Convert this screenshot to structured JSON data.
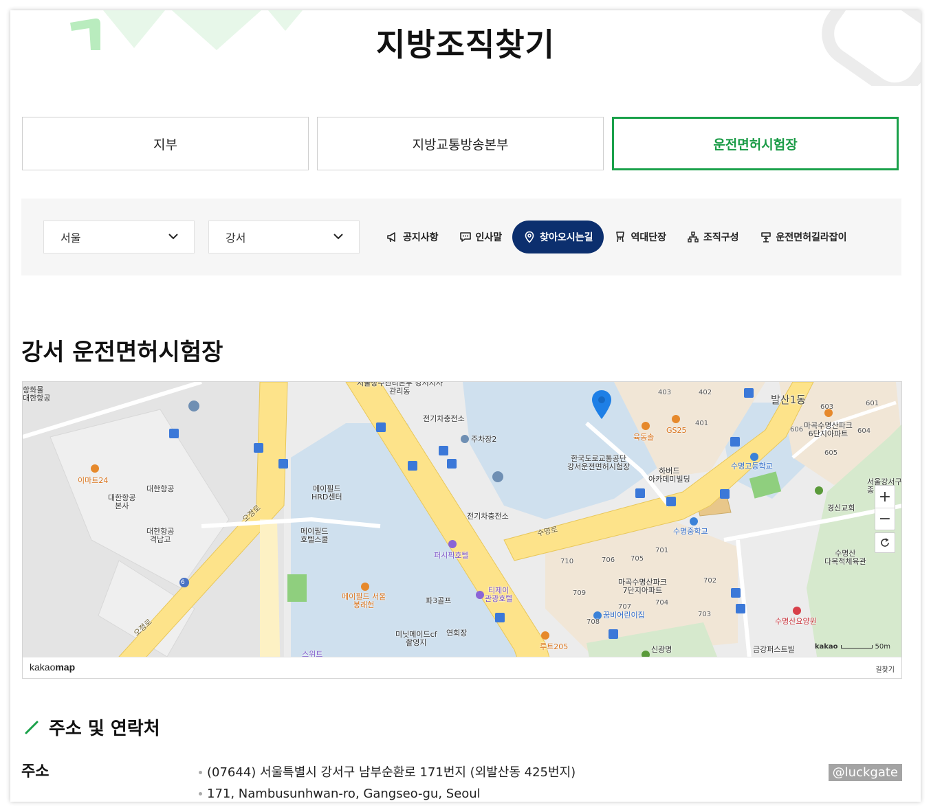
{
  "page_title": "지방조직찾기",
  "tabs": [
    {
      "label": "지부"
    },
    {
      "label": "지방교통방송본부"
    },
    {
      "label": "운전면허시험장"
    }
  ],
  "filters": {
    "region": "서울",
    "branch": "강서"
  },
  "quick_links": [
    {
      "label": "공지사항",
      "icon": "megaphone-icon"
    },
    {
      "label": "인사말",
      "icon": "chat-icon"
    },
    {
      "label": "찾아오시는길",
      "icon": "location-pin-icon",
      "active": true
    },
    {
      "label": "역대단장",
      "icon": "person-icon"
    },
    {
      "label": "조직구성",
      "icon": "org-chart-icon"
    },
    {
      "label": "운전면허길라잡이",
      "icon": "signpost-icon"
    }
  ],
  "section_title": "강서 운전면허시험장",
  "map": {
    "labels": {
      "top_left_1": "항화물",
      "top_left_2": "대한항공",
      "emart": "이마트24",
      "kal_hq": "대한항공\n본사",
      "kal": "대한항공",
      "kal_hangar": "대한항공\n격납고",
      "ojeong_1": "오정로",
      "ojeong_2": "오정로",
      "route_6": "6",
      "hrd": "메이필드\nHRD센터",
      "hotel_school": "메이필드\n호텔스쿨",
      "bongraehun": "메이필드 서울\n봉래헌",
      "pacific": "퍼시픽호텔",
      "par3": "파3골프",
      "mixmade": "미닛메이드cf\n촬영지",
      "yeonhoe": "연회장",
      "tj": "티제이\n관광호텔",
      "ev_1": "전기차충전소",
      "parking_2": "주차장2",
      "ev_2": "전기차충전소",
      "top_center": "서울상수관리본부 강서지사\n관리동",
      "sumyeongro": "수명로",
      "test_site": "한국도로교통공단\n강서운전면허시험장",
      "yukdongsol": "육동솔",
      "gs25": "GS25",
      "harvard": "하버드\n아카데미빌딩",
      "sumyeong_high": "수명고등학교",
      "sumyeong_mid": "수명중학교",
      "balsan1": "발산1동",
      "magok6": "마곡수명산파크\n6단지아파트",
      "magok7": "마곡수명산파크\n7단지아파트",
      "kkumbee": "꿈비어린이집",
      "route205": "루트205",
      "singwang": "신광명",
      "geumgang": "금강퍼스트빌",
      "nursing": "수명산요양원",
      "gyeongsin": "경신교회",
      "gangseo_gu": "서울강서구\n종",
      "sumyeongsan_gym": "수명산\n다목적체육관",
      "bldg_403": "403",
      "bldg_402": "402",
      "bldg_401": "401",
      "bldg_601": "601",
      "bldg_603": "603",
      "bldg_604": "604",
      "bldg_605": "605",
      "bldg_606": "606",
      "bldg_701": "701",
      "bldg_702": "702",
      "bldg_703": "703",
      "bldg_704": "704",
      "bldg_705": "705",
      "bldg_706": "706",
      "bldg_707": "707",
      "bldg_708": "708",
      "bldg_709": "709",
      "bldg_710": "710",
      "suite": "스위트"
    },
    "brand_light": "kakao",
    "brand_bold": "map",
    "route_link": "길찾기",
    "scale_brand": "kakao",
    "scale_label": "50m",
    "zoom_in": "+",
    "zoom_out": "−"
  },
  "contact_title": "주소 및 연락처",
  "address": {
    "label": "주소",
    "lines": [
      "(07644) 서울특별시 강서구 남부순환로 171번지 (외발산동 425번지)",
      "171, Nambusunhwan-ro, Gangseo-gu, Seoul"
    ]
  },
  "watermark": "@luckgate",
  "colors": {
    "accent_green": "#1aa14a",
    "active_navy": "#0c2f6e",
    "marker_blue": "#1e7fe6",
    "road_yellow": "#fde38a"
  }
}
